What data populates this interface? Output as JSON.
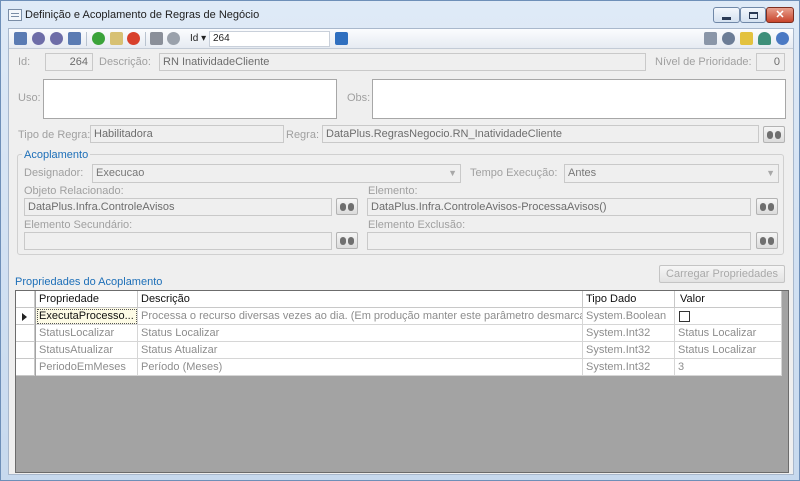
{
  "window": {
    "title": "Definição e Acoplamento de Regras de Negócio",
    "accent": "#1d6fb8"
  },
  "toolbar": {
    "left_icons": [
      "first-record-icon",
      "previous-record-icon",
      "next-record-icon",
      "last-record-icon",
      "add-icon",
      "edit-icon",
      "delete-icon",
      "save-icon",
      "undo-icon"
    ],
    "id_combo_label": "Id",
    "id_combo_arrow": "▾",
    "id_value": "264",
    "right_icons": [
      "filter-icon",
      "settings-icon",
      "note-icon",
      "person-icon",
      "help-icon"
    ]
  },
  "form": {
    "id_label": "Id:",
    "id_value": "264",
    "descricao_label": "Descrição:",
    "descricao_value": "RN InatividadeCliente",
    "prioridade_label": "Nível de Prioridade:",
    "prioridade_value": "0",
    "uso_label": "Uso:",
    "obs_label": "Obs:",
    "tipo_label": "Tipo de Regra:",
    "tipo_value": "Habilitadora",
    "regra_label": "Regra:",
    "regra_value": "DataPlus.RegrasNegocio.RN_InatividadeCliente"
  },
  "acoplamento": {
    "title": "Acoplamento",
    "designador_label": "Designador:",
    "designador_value": "Execucao",
    "tempo_label": "Tempo Execução:",
    "tempo_value": "Antes",
    "objeto_label": "Objeto Relacionado:",
    "objeto_value": "DataPlus.Infra.ControleAvisos",
    "elemento_label": "Elemento:",
    "elemento_value": "DataPlus.Infra.ControleAvisos-ProcessaAvisos()",
    "elem_sec_label": "Elemento Secundário:",
    "elem_sec_value": "",
    "elem_exc_label": "Elemento Exclusão:",
    "elem_exc_value": ""
  },
  "propriedades": {
    "title": "Propriedades do Acoplamento",
    "load_button": "Carregar Propriedades",
    "columns": [
      "Propriedade",
      "Descrição",
      "Tipo Dado",
      "Valor"
    ],
    "rows": [
      [
        "ExecutaProcesso...",
        "Processa o recurso diversas vezes ao dia. (Em produção manter este parâmetro desmarcado)",
        "System.Boolean",
        ""
      ],
      [
        "StatusLocalizar",
        "Status Localizar",
        "System.Int32",
        "Status Localizar"
      ],
      [
        "StatusAtualizar",
        "Status Atualizar",
        "System.Int32",
        "Status Localizar"
      ],
      [
        "PeriodoEmMeses",
        "Período (Meses)",
        "System.Int32",
        "3"
      ]
    ]
  }
}
